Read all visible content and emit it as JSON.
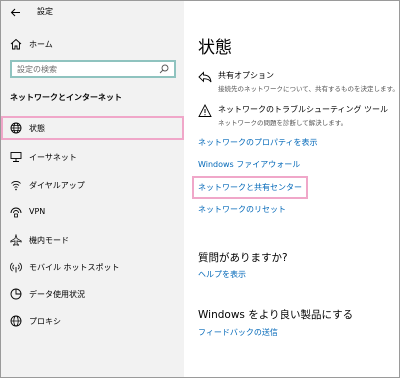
{
  "window": {
    "title": "設定"
  },
  "nav": {
    "home_label": "ホーム",
    "search_placeholder": "設定の検索",
    "section_heading": "ネットワークとインターネット",
    "items": [
      {
        "label": "状態",
        "icon": "globe-icon",
        "selected": true
      },
      {
        "label": "イーサネット",
        "icon": "ethernet-icon"
      },
      {
        "label": "ダイヤルアップ",
        "icon": "dialup-icon"
      },
      {
        "label": "VPN",
        "icon": "vpn-icon"
      },
      {
        "label": "機内モード",
        "icon": "airplane-icon"
      },
      {
        "label": "モバイル ホットスポット",
        "icon": "hotspot-icon"
      },
      {
        "label": "データ使用状況",
        "icon": "data-usage-icon"
      },
      {
        "label": "プロキシ",
        "icon": "proxy-globe-icon"
      }
    ]
  },
  "main": {
    "title": "状態",
    "options": [
      {
        "title": "共有オプション",
        "desc": "接続先のネットワークについて、共有するものを決定します。",
        "icon": "share-icon"
      },
      {
        "title": "ネットワークのトラブルシューティング ツール",
        "desc": "ネットワークの問題を診断して解決します。",
        "icon": "warning-icon"
      }
    ],
    "links": [
      "ネットワークのプロパティを表示",
      "Windows ファイアウォール",
      "ネットワークと共有センター",
      "ネットワークのリセット"
    ],
    "question_heading": "質問がありますか?",
    "help_link": "ヘルプを表示",
    "improve_heading": "Windows をより良い製品にする",
    "feedback_link": "フィードバックの送信"
  },
  "colors": {
    "link": "#0067b8",
    "highlight_box": "#f0a7c9",
    "search_border": "#8fc3bf"
  }
}
